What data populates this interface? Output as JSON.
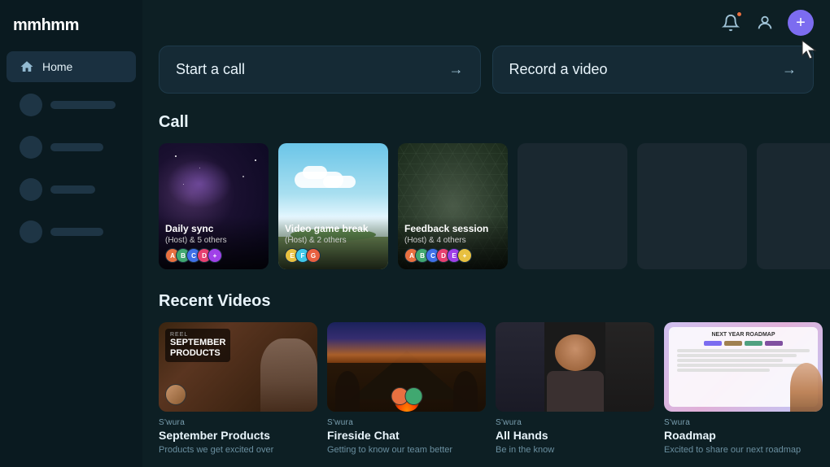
{
  "app": {
    "logo": "mmhmm"
  },
  "sidebar": {
    "home_label": "Home",
    "items": [
      {
        "label": ""
      },
      {
        "label": ""
      },
      {
        "label": ""
      },
      {
        "label": ""
      }
    ]
  },
  "header": {
    "notifications_icon": "bell-icon",
    "profile_icon": "user-icon",
    "add_icon": "plus-icon"
  },
  "actions": {
    "start_call_label": "Start a call",
    "record_video_label": "Record a video"
  },
  "call_section": {
    "title": "Call",
    "cards": [
      {
        "title": "Daily sync",
        "subtitle": "(Host) & 5 others",
        "bg": "galaxy"
      },
      {
        "title": "Video game break",
        "subtitle": "(Host) & 2 others",
        "bg": "sky"
      },
      {
        "title": "Feedback session",
        "subtitle": "(Host) & 4 others",
        "bg": "hex"
      },
      {
        "bg": "dark"
      },
      {
        "bg": "dark"
      },
      {
        "bg": "dark"
      }
    ]
  },
  "recent_videos": {
    "title": "Recent Videos",
    "videos": [
      {
        "meta": "S'wura",
        "title": "September Products",
        "desc": "Products we get excited over",
        "bg": "september"
      },
      {
        "meta": "S'wura",
        "title": "Fireside Chat",
        "desc": "Getting to know our team better",
        "bg": "fireside"
      },
      {
        "meta": "S'wura",
        "title": "All Hands",
        "desc": "Be in the know",
        "bg": "allhands"
      },
      {
        "meta": "S'wura",
        "title": "Roadmap",
        "desc": "Excited to share our next roadmap",
        "bg": "roadmap"
      }
    ]
  }
}
